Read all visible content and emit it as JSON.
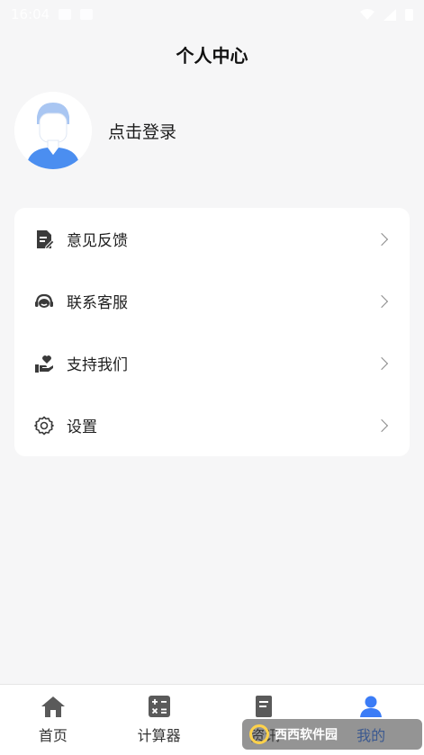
{
  "status_bar": {
    "time": "16:04"
  },
  "header": {
    "title": "个人中心"
  },
  "profile": {
    "login_text": "点击登录"
  },
  "menu": {
    "items": [
      {
        "label": "意见反馈",
        "icon": "feedback-document-icon"
      },
      {
        "label": "联系客服",
        "icon": "headset-icon"
      },
      {
        "label": "支持我们",
        "icon": "hand-heart-icon"
      },
      {
        "label": "设置",
        "icon": "gear-icon"
      }
    ]
  },
  "tabs": [
    {
      "label": "首页",
      "icon": "home-icon",
      "active": false
    },
    {
      "label": "计算器",
      "icon": "calculator-icon",
      "active": false
    },
    {
      "label": "资讯",
      "icon": "news-icon",
      "active": false
    },
    {
      "label": "我的",
      "icon": "user-icon",
      "active": true
    }
  ],
  "watermark": {
    "text": "西西软件园"
  },
  "colors": {
    "accent": "#3b7cf6",
    "avatar_blue": "#4b8ef0",
    "background": "#f6f6f7"
  }
}
